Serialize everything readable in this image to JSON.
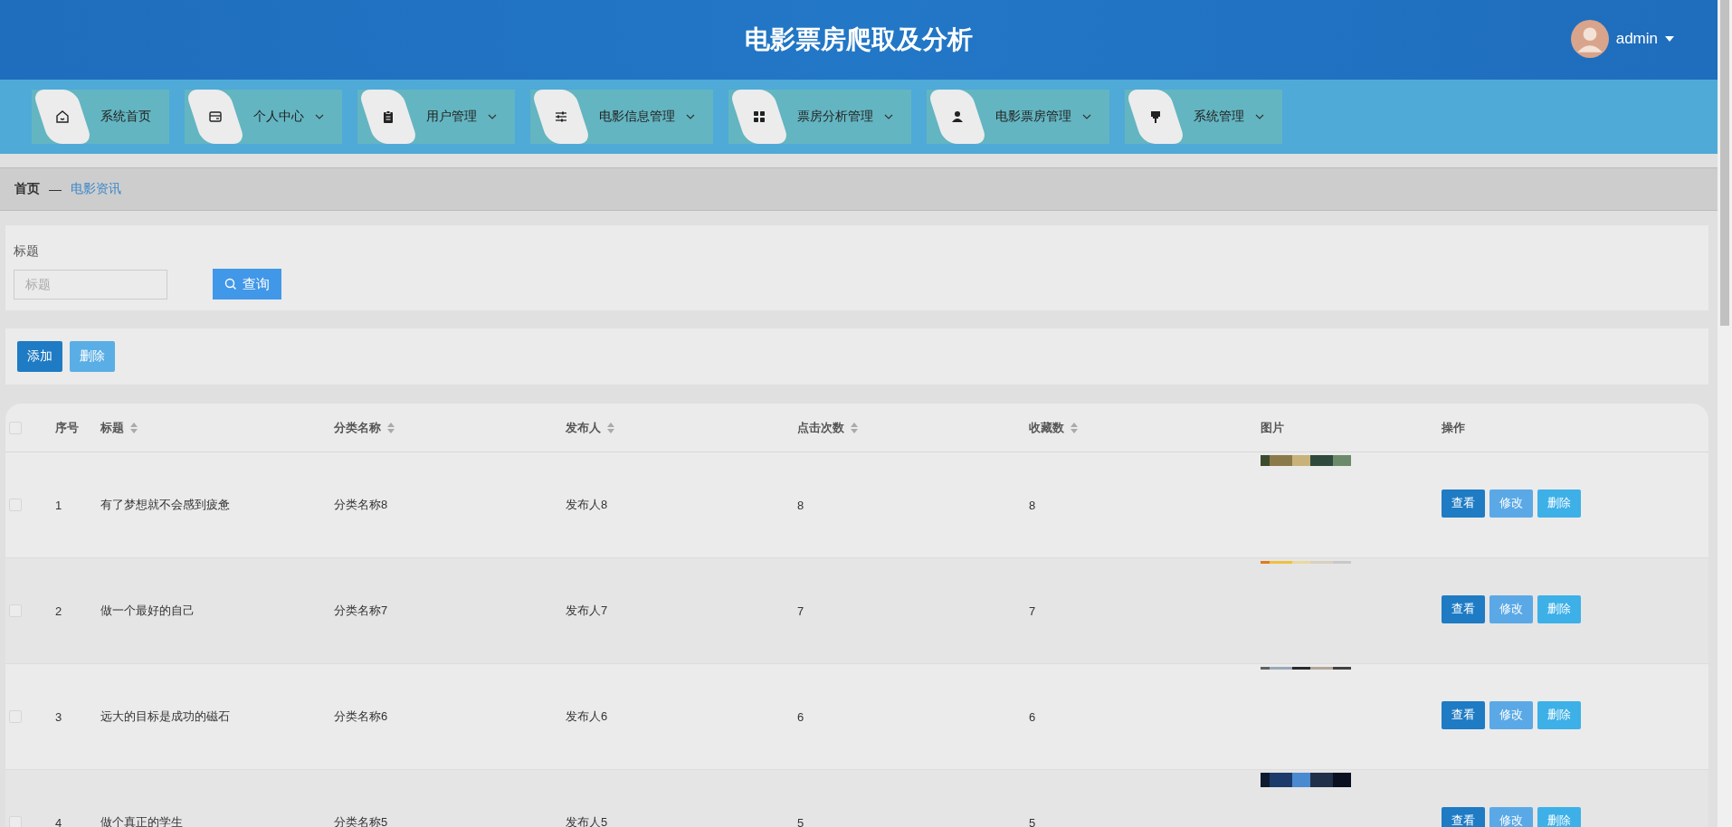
{
  "header": {
    "title": "电影票房爬取及分析",
    "user": {
      "name": "admin"
    }
  },
  "nav": [
    {
      "label": "系统首页",
      "kind": "home",
      "dropdown": false
    },
    {
      "label": "个人中心",
      "kind": "card",
      "dropdown": true
    },
    {
      "label": "用户管理",
      "kind": "clipboard",
      "dropdown": true
    },
    {
      "label": "电影信息管理",
      "kind": "sliders",
      "dropdown": true
    },
    {
      "label": "票房分析管理",
      "kind": "grid",
      "dropdown": true
    },
    {
      "label": "电影票房管理",
      "kind": "person",
      "dropdown": true
    },
    {
      "label": "系统管理",
      "kind": "brush",
      "dropdown": true
    }
  ],
  "breadcrumb": {
    "separator": "—",
    "items": [
      {
        "label": "首页",
        "current": false
      },
      {
        "label": "电影资讯",
        "current": true
      }
    ]
  },
  "search": {
    "label": "标题",
    "placeholder": "标题",
    "button": "查询"
  },
  "actions": [
    {
      "label": "添加",
      "kind": "add"
    },
    {
      "label": "删除",
      "kind": "delete"
    }
  ],
  "table": {
    "select_all": {
      "checked": false
    },
    "columns": [
      {
        "label": "序号",
        "sortable": false
      },
      {
        "label": "标题",
        "sortable": true
      },
      {
        "label": "分类名称",
        "sortable": true
      },
      {
        "label": "发布人",
        "sortable": true
      },
      {
        "label": "点击次数",
        "sortable": true
      },
      {
        "label": "收藏数",
        "sortable": true
      },
      {
        "label": "图片",
        "sortable": false
      },
      {
        "label": "操作",
        "sortable": false
      }
    ],
    "rows": [
      {
        "checked": false,
        "cells": [
          "1",
          "有了梦想就不会感到疲惫",
          "分类名称8",
          "发布人8",
          "8",
          "8"
        ],
        "picture": {
          "kind": "picture"
        },
        "buttons": [
          {
            "label": "查看",
            "kind": "view"
          },
          {
            "label": "修改",
            "kind": "edit"
          },
          {
            "label": "删除",
            "kind": "delete"
          }
        ]
      },
      {
        "checked": false,
        "cells": [
          "2",
          "做一个最好的自己",
          "分类名称7",
          "发布人7",
          "7",
          "7"
        ],
        "picture": {
          "kind": "picture"
        },
        "buttons": [
          {
            "label": "查看",
            "kind": "view"
          },
          {
            "label": "修改",
            "kind": "edit"
          },
          {
            "label": "删除",
            "kind": "delete"
          }
        ]
      },
      {
        "checked": false,
        "cells": [
          "3",
          "远大的目标是成功的磁石",
          "分类名称6",
          "发布人6",
          "6",
          "6"
        ],
        "picture": {
          "kind": "picture"
        },
        "buttons": [
          {
            "label": "查看",
            "kind": "view"
          },
          {
            "label": "修改",
            "kind": "edit"
          },
          {
            "label": "删除",
            "kind": "delete"
          }
        ]
      },
      {
        "checked": false,
        "cells": [
          "4",
          "做个真正的学生",
          "分类名称5",
          "发布人5",
          "5",
          "5"
        ],
        "picture": {
          "kind": "picture"
        },
        "buttons": [
          {
            "label": "查看",
            "kind": "view"
          },
          {
            "label": "修改",
            "kind": "edit"
          },
          {
            "label": "删除",
            "kind": "delete"
          }
        ]
      }
    ]
  }
}
